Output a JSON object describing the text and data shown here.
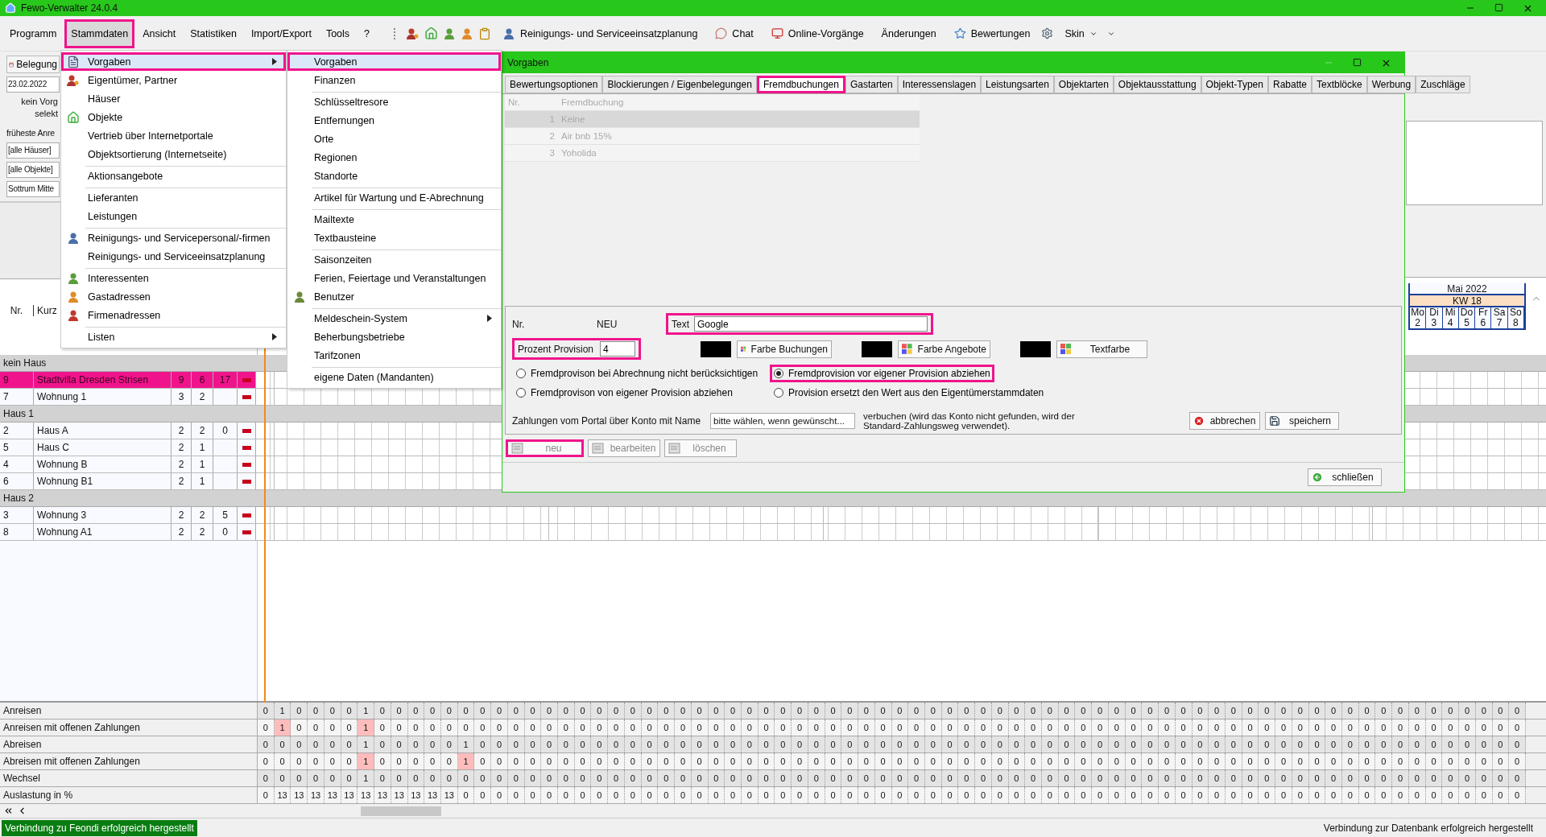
{
  "window": {
    "title": "Fewo-Verwalter 24.0.4"
  },
  "menu_bar": [
    {
      "label": "Programm",
      "selected": false,
      "highlighted": false
    },
    {
      "label": "Stammdaten",
      "selected": true,
      "highlighted": true
    },
    {
      "label": "Ansicht",
      "selected": false,
      "highlighted": false
    },
    {
      "label": "Statistiken",
      "selected": false,
      "highlighted": false
    },
    {
      "label": "Import/Export",
      "selected": false,
      "highlighted": false
    },
    {
      "label": "Tools",
      "selected": false,
      "highlighted": false
    },
    {
      "label": "?",
      "selected": false,
      "highlighted": false
    }
  ],
  "toolbar": [
    {
      "label": "Reinigungs- und Serviceeinsatzplanung"
    },
    {
      "label": "Chat"
    },
    {
      "label": "Online-Vorgänge"
    },
    {
      "label": "Änderungen"
    },
    {
      "label": "Bewertungen"
    }
  ],
  "skin_menu": "Skin",
  "stammdaten_menu": [
    {
      "label": "Vorgaben",
      "selected": true,
      "highlighted": true,
      "has_submenu": true,
      "separator_before": false
    },
    {
      "label": "Eigentümer, Partner",
      "selected": false,
      "highlighted": false,
      "has_submenu": false,
      "separator_before": false
    },
    {
      "label": "Häuser",
      "selected": false,
      "highlighted": false,
      "has_submenu": false,
      "separator_before": false
    },
    {
      "label": "Objekte",
      "selected": false,
      "highlighted": false,
      "has_submenu": false,
      "separator_before": false
    },
    {
      "label": "Vertrieb über Internetportale",
      "selected": false,
      "highlighted": false,
      "has_submenu": false,
      "separator_before": false
    },
    {
      "label": "Objektsortierung (Internetseite)",
      "selected": false,
      "highlighted": false,
      "has_submenu": false,
      "separator_before": false
    },
    {
      "label": "Aktionsangebote",
      "selected": false,
      "highlighted": false,
      "has_submenu": false,
      "separator_before": true
    },
    {
      "label": "Lieferanten",
      "selected": false,
      "highlighted": false,
      "has_submenu": false,
      "separator_before": true
    },
    {
      "label": "Leistungen",
      "selected": false,
      "highlighted": false,
      "has_submenu": false,
      "separator_before": false
    },
    {
      "label": "Reinigungs- und Servicepersonal/-firmen",
      "selected": false,
      "highlighted": false,
      "has_submenu": false,
      "separator_before": true
    },
    {
      "label": "Reinigungs- und Serviceeinsatzplanung",
      "selected": false,
      "highlighted": false,
      "has_submenu": false,
      "separator_before": false
    },
    {
      "label": "Interessenten",
      "selected": false,
      "highlighted": false,
      "has_submenu": false,
      "separator_before": true
    },
    {
      "label": "Gastadressen",
      "selected": false,
      "highlighted": false,
      "has_submenu": false,
      "separator_before": false
    },
    {
      "label": "Firmenadressen",
      "selected": false,
      "highlighted": false,
      "has_submenu": false,
      "separator_before": false
    },
    {
      "label": "Listen",
      "selected": false,
      "highlighted": false,
      "has_submenu": true,
      "separator_before": true
    }
  ],
  "vorgaben_submenu": [
    {
      "label": "Vorgaben",
      "selected": true,
      "highlighted": true,
      "has_submenu": false,
      "separator_before": false
    },
    {
      "label": "Finanzen",
      "selected": false,
      "highlighted": false,
      "has_submenu": false,
      "separator_before": false
    },
    {
      "label": "Schlüsseltresore",
      "selected": false,
      "highlighted": false,
      "has_submenu": false,
      "separator_before": true
    },
    {
      "label": "Entfernungen",
      "selected": false,
      "highlighted": false,
      "has_submenu": false,
      "separator_before": false
    },
    {
      "label": "Orte",
      "selected": false,
      "highlighted": false,
      "has_submenu": false,
      "separator_before": false
    },
    {
      "label": "Regionen",
      "selected": false,
      "highlighted": false,
      "has_submenu": false,
      "separator_before": false
    },
    {
      "label": "Standorte",
      "selected": false,
      "highlighted": false,
      "has_submenu": false,
      "separator_before": false
    },
    {
      "label": "Artikel für Wartung und E-Abrechnung",
      "selected": false,
      "highlighted": false,
      "has_submenu": false,
      "separator_before": true
    },
    {
      "label": "Mailtexte",
      "selected": false,
      "highlighted": false,
      "has_submenu": false,
      "separator_before": true
    },
    {
      "label": "Textbausteine",
      "selected": false,
      "highlighted": false,
      "has_submenu": false,
      "separator_before": false
    },
    {
      "label": "Saisonzeiten",
      "selected": false,
      "highlighted": false,
      "has_submenu": false,
      "separator_before": true
    },
    {
      "label": "Ferien, Feiertage und Veranstaltungen",
      "selected": false,
      "highlighted": false,
      "has_submenu": false,
      "separator_before": false
    },
    {
      "label": "Benutzer",
      "selected": false,
      "highlighted": false,
      "has_submenu": false,
      "separator_before": false
    },
    {
      "label": "Meldeschein-System",
      "selected": false,
      "highlighted": false,
      "has_submenu": true,
      "separator_before": true
    },
    {
      "label": "Beherbungsbetriebe",
      "selected": false,
      "highlighted": false,
      "has_submenu": false,
      "separator_before": false
    },
    {
      "label": "Tarifzonen",
      "selected": false,
      "highlighted": false,
      "has_submenu": false,
      "separator_before": false
    },
    {
      "label": "eigene Daten (Mandanten)",
      "selected": false,
      "highlighted": false,
      "has_submenu": false,
      "separator_before": true
    }
  ],
  "left_panel": {
    "view_button": "Belegung",
    "date": "23.02.2022",
    "selection_note": [
      "kein Vorg",
      "selekt"
    ],
    "earliest_label": "früheste Anre",
    "filters": [
      "[alle Häuser]",
      "[alle Objekte]",
      "Sottrum Mitte"
    ]
  },
  "object_table": {
    "columns": [
      "Nr.",
      "Kurz"
    ],
    "rows": [
      {
        "kind": "group",
        "label": "kein Haus"
      },
      {
        "kind": "object",
        "nr": "9",
        "name": "Stadtvilla Dresden Strisen",
        "col_3": "9",
        "col_4": "6",
        "col_5": "17",
        "selected": true
      },
      {
        "kind": "object",
        "nr": "7",
        "name": "Wohnung 1",
        "col_3": "3",
        "col_4": "2",
        "col_5": "",
        "selected": false
      },
      {
        "kind": "group",
        "label": "Haus 1"
      },
      {
        "kind": "object",
        "nr": "2",
        "name": "Haus A",
        "col_3": "2",
        "col_4": "2",
        "col_5": "0",
        "selected": false
      },
      {
        "kind": "object",
        "nr": "5",
        "name": "Haus C",
        "col_3": "2",
        "col_4": "1",
        "col_5": "",
        "selected": false
      },
      {
        "kind": "object",
        "nr": "4",
        "name": "Wohnung B",
        "col_3": "2",
        "col_4": "1",
        "col_5": "",
        "selected": false
      },
      {
        "kind": "object",
        "nr": "6",
        "name": "Wohnung B1",
        "col_3": "2",
        "col_4": "1",
        "col_5": "",
        "selected": false
      },
      {
        "kind": "group",
        "label": "Haus 2"
      },
      {
        "kind": "object",
        "nr": "3",
        "name": "Wohnung 3",
        "col_3": "2",
        "col_4": "2",
        "col_5": "5",
        "selected": false
      },
      {
        "kind": "object",
        "nr": "8",
        "name": "Wohnung A1",
        "col_3": "2",
        "col_4": "2",
        "col_5": "0",
        "selected": false
      }
    ]
  },
  "calendar": {
    "month": "Mai 2022",
    "week": "KW 18",
    "days": [
      {
        "name": "Mo",
        "date": "2"
      },
      {
        "name": "Di",
        "date": "3"
      },
      {
        "name": "Mi",
        "date": "4"
      },
      {
        "name": "Do",
        "date": "5"
      },
      {
        "name": "Fr",
        "date": "6"
      },
      {
        "name": "Sa",
        "date": "7"
      },
      {
        "name": "So",
        "date": "8"
      }
    ]
  },
  "stats": [
    {
      "label": "Anreisen",
      "values": [
        "0",
        "1",
        "0",
        "0",
        "0",
        "0",
        "1",
        "0",
        "0",
        "0",
        "0",
        "0",
        "0",
        "0",
        "0",
        "0",
        "0",
        "0",
        "0",
        "0",
        "0",
        "0",
        "0",
        "0",
        "0",
        "0",
        "0",
        "0",
        "0",
        "0",
        "0",
        "0",
        "0",
        "0",
        "0",
        "0",
        "0",
        "0",
        "0",
        "0",
        "0",
        "0",
        "0",
        "0",
        "0",
        "0",
        "0",
        "0",
        "0",
        "0",
        "0",
        "0",
        "0",
        "0",
        "0",
        "0",
        "0",
        "0",
        "0",
        "0",
        "0",
        "0",
        "0",
        "0",
        "0",
        "0",
        "0",
        "0",
        "0",
        "0",
        "0",
        "0",
        "0",
        "0",
        "0",
        "0"
      ]
    },
    {
      "label": "Anreisen mit offenen Zahlungen",
      "values": [
        "0",
        "1",
        "0",
        "0",
        "0",
        "0",
        "1",
        "0",
        "0",
        "0",
        "0",
        "0",
        "0",
        "0",
        "0",
        "0",
        "0",
        "0",
        "0",
        "0",
        "0",
        "0",
        "0",
        "0",
        "0",
        "0",
        "0",
        "0",
        "0",
        "0",
        "0",
        "0",
        "0",
        "0",
        "0",
        "0",
        "0",
        "0",
        "0",
        "0",
        "0",
        "0",
        "0",
        "0",
        "0",
        "0",
        "0",
        "0",
        "0",
        "0",
        "0",
        "0",
        "0",
        "0",
        "0",
        "0",
        "0",
        "0",
        "0",
        "0",
        "0",
        "0",
        "0",
        "0",
        "0",
        "0",
        "0",
        "0",
        "0",
        "0",
        "0",
        "0",
        "0",
        "0",
        "0",
        "0"
      ],
      "open": [
        false,
        true,
        false,
        false,
        false,
        false,
        true,
        false,
        false,
        false,
        false,
        false,
        false,
        false,
        false,
        false,
        false,
        false,
        false,
        false,
        false,
        false,
        false,
        false,
        false,
        false,
        false,
        false,
        false,
        false,
        false,
        false,
        false,
        false,
        false,
        false,
        false,
        false,
        false,
        false,
        false,
        false,
        false,
        false,
        false,
        false,
        false,
        false,
        false,
        false,
        false,
        false,
        false,
        false,
        false,
        false,
        false,
        false,
        false,
        false,
        false,
        false,
        false,
        false,
        false,
        false,
        false,
        false,
        false,
        false,
        false,
        false,
        false,
        false,
        false,
        false
      ]
    },
    {
      "label": "Abreisen",
      "values": [
        "0",
        "0",
        "0",
        "0",
        "0",
        "0",
        "1",
        "0",
        "0",
        "0",
        "0",
        "0",
        "1",
        "0",
        "0",
        "0",
        "0",
        "0",
        "0",
        "0",
        "0",
        "0",
        "0",
        "0",
        "0",
        "0",
        "0",
        "0",
        "0",
        "0",
        "0",
        "0",
        "0",
        "0",
        "0",
        "0",
        "0",
        "0",
        "0",
        "0",
        "0",
        "0",
        "0",
        "0",
        "0",
        "0",
        "0",
        "0",
        "0",
        "0",
        "0",
        "0",
        "0",
        "0",
        "0",
        "0",
        "0",
        "0",
        "0",
        "0",
        "0",
        "0",
        "0",
        "0",
        "0",
        "0",
        "0",
        "0",
        "0",
        "0",
        "0",
        "0",
        "0",
        "0",
        "0",
        "0"
      ]
    },
    {
      "label": "Abreisen mit offenen Zahlungen",
      "values": [
        "0",
        "0",
        "0",
        "0",
        "0",
        "0",
        "1",
        "0",
        "0",
        "0",
        "0",
        "0",
        "1",
        "0",
        "0",
        "0",
        "0",
        "0",
        "0",
        "0",
        "0",
        "0",
        "0",
        "0",
        "0",
        "0",
        "0",
        "0",
        "0",
        "0",
        "0",
        "0",
        "0",
        "0",
        "0",
        "0",
        "0",
        "0",
        "0",
        "0",
        "0",
        "0",
        "0",
        "0",
        "0",
        "0",
        "0",
        "0",
        "0",
        "0",
        "0",
        "0",
        "0",
        "0",
        "0",
        "0",
        "0",
        "0",
        "0",
        "0",
        "0",
        "0",
        "0",
        "0",
        "0",
        "0",
        "0",
        "0",
        "0",
        "0",
        "0",
        "0",
        "0",
        "0",
        "0",
        "0"
      ],
      "open": [
        false,
        false,
        false,
        false,
        false,
        false,
        true,
        false,
        false,
        false,
        false,
        false,
        true,
        false,
        false,
        false,
        false,
        false,
        false,
        false,
        false,
        false,
        false,
        false,
        false,
        false,
        false,
        false,
        false,
        false,
        false,
        false,
        false,
        false,
        false,
        false,
        false,
        false,
        false,
        false,
        false,
        false,
        false,
        false,
        false,
        false,
        false,
        false,
        false,
        false,
        false,
        false,
        false,
        false,
        false,
        false,
        false,
        false,
        false,
        false,
        false,
        false,
        false,
        false,
        false,
        false,
        false,
        false,
        false,
        false,
        false,
        false,
        false,
        false,
        false,
        false
      ]
    },
    {
      "label": "Wechsel",
      "values": [
        "0",
        "0",
        "0",
        "0",
        "0",
        "0",
        "1",
        "0",
        "0",
        "0",
        "0",
        "0",
        "0",
        "0",
        "0",
        "0",
        "0",
        "0",
        "0",
        "0",
        "0",
        "0",
        "0",
        "0",
        "0",
        "0",
        "0",
        "0",
        "0",
        "0",
        "0",
        "0",
        "0",
        "0",
        "0",
        "0",
        "0",
        "0",
        "0",
        "0",
        "0",
        "0",
        "0",
        "0",
        "0",
        "0",
        "0",
        "0",
        "0",
        "0",
        "0",
        "0",
        "0",
        "0",
        "0",
        "0",
        "0",
        "0",
        "0",
        "0",
        "0",
        "0",
        "0",
        "0",
        "0",
        "0",
        "0",
        "0",
        "0",
        "0",
        "0",
        "0",
        "0",
        "0",
        "0",
        "0"
      ]
    },
    {
      "label": "Auslastung in %",
      "values": [
        "0",
        "13",
        "13",
        "13",
        "13",
        "13",
        "13",
        "13",
        "13",
        "13",
        "13",
        "13",
        "0",
        "0",
        "0",
        "0",
        "0",
        "0",
        "0",
        "0",
        "0",
        "0",
        "0",
        "0",
        "0",
        "0",
        "0",
        "0",
        "0",
        "0",
        "0",
        "0",
        "0",
        "0",
        "0",
        "0",
        "0",
        "0",
        "0",
        "0",
        "0",
        "0",
        "0",
        "0",
        "0",
        "0",
        "0",
        "0",
        "0",
        "0",
        "0",
        "0",
        "0",
        "0",
        "0",
        "0",
        "0",
        "0",
        "0",
        "0",
        "0",
        "0",
        "0",
        "0",
        "0",
        "0",
        "0",
        "0",
        "0",
        "0",
        "0",
        "0",
        "0",
        "0",
        "0",
        "0"
      ]
    }
  ],
  "status_bar": {
    "left": "Verbindung zu Feondi erfolgreich hergestellt",
    "right": "Verbindung zur Datenbank erfolgreich hergestellt"
  },
  "dialog": {
    "title": "Vorgaben",
    "tabs": [
      {
        "label": "Bewertungsoptionen",
        "selected": false,
        "highlighted": false
      },
      {
        "label": "Blockierungen / Eigenbelegungen",
        "selected": false,
        "highlighted": false
      },
      {
        "label": "Fremdbuchungen",
        "selected": true,
        "highlighted": true
      },
      {
        "label": "Gastarten",
        "selected": false,
        "highlighted": false
      },
      {
        "label": "Interessenslagen",
        "selected": false,
        "highlighted": false
      },
      {
        "label": "Leistungsarten",
        "selected": false,
        "highlighted": false
      },
      {
        "label": "Objektarten",
        "selected": false,
        "highlighted": false
      },
      {
        "label": "Objektausstattung",
        "selected": false,
        "highlighted": false
      },
      {
        "label": "Objekt-Typen",
        "selected": false,
        "highlighted": false
      },
      {
        "label": "Rabatte",
        "selected": false,
        "highlighted": false
      },
      {
        "label": "Textblöcke",
        "selected": false,
        "highlighted": false
      },
      {
        "label": "Werbung",
        "selected": false,
        "highlighted": false
      },
      {
        "label": "Zuschläge",
        "selected": false,
        "highlighted": false
      }
    ],
    "list": {
      "columns": [
        "Nr.",
        "Fremdbuchung"
      ],
      "rows": [
        {
          "nr": "1",
          "name": "Keine",
          "selected": true
        },
        {
          "nr": "2",
          "name": "Air bnb 15%",
          "selected": false
        },
        {
          "nr": "3",
          "name": "Yoholida",
          "selected": false
        }
      ]
    },
    "form": {
      "nr_label": "Nr.",
      "nr_value": "NEU",
      "text_label": "Text",
      "text_value": "Google",
      "text_highlighted": true,
      "percent_label": "Prozent Provision",
      "percent_value": "4",
      "percent_highlighted": true,
      "color_buttons": [
        "Farbe Buchungen",
        "Farbe Angebote",
        "Textfarbe"
      ],
      "options": [
        {
          "label": "Fremdprovison bei Abrechnung nicht berücksichtigen",
          "selected": false,
          "highlighted": false
        },
        {
          "label": "Fremdprovision vor eigener Provision abziehen",
          "selected": true,
          "highlighted": true
        },
        {
          "label": "Fremdprovison von eigener Provision abziehen",
          "selected": false,
          "highlighted": false
        },
        {
          "label": "Provision ersetzt den Wert aus den Eigentümerstammdaten",
          "selected": false,
          "highlighted": false
        }
      ],
      "payment_label": "Zahlungen vom Portal über Konto mit Name",
      "payment_select": "bitte wählen, wenn gewünscht...",
      "payment_note": [
        "verbuchen (wird das Konto nicht gefunden, wird der",
        "Standard-Zahlungsweg verwendet)."
      ],
      "cancel": "abbrechen",
      "save": "speichern"
    },
    "list_buttons": [
      {
        "label": "neu",
        "disabled": true,
        "highlighted": true
      },
      {
        "label": "bearbeiten",
        "disabled": true,
        "highlighted": false
      },
      {
        "label": "löschen",
        "disabled": true,
        "highlighted": false
      }
    ],
    "close": "schließen"
  }
}
